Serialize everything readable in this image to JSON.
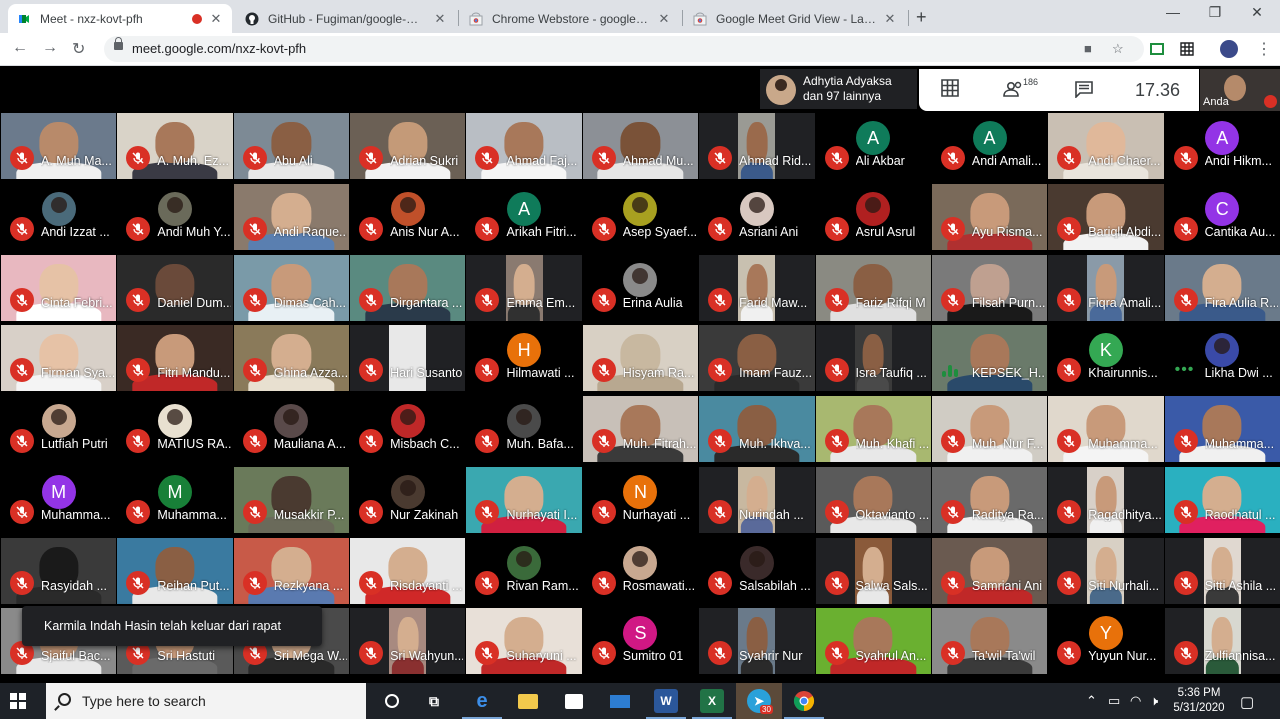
{
  "browser": {
    "tabs": [
      {
        "title": "Meet - nxz-kovt-pfh",
        "active": true,
        "recording": true,
        "icon": "meet-icon"
      },
      {
        "title": "GitHub - Fugiman/google-meet",
        "active": false,
        "icon": "github-icon"
      },
      {
        "title": "Chrome Webstore - google mee",
        "active": false,
        "icon": "chrome-webstore-icon"
      },
      {
        "title": "Google Meet Grid View - Lapork",
        "active": false,
        "icon": "chrome-webstore-icon"
      }
    ],
    "new_tab": "+",
    "url": "meet.google.com/nxz-kovt-pfh"
  },
  "meet": {
    "speaker_line1": "Adhytia Adyaksa",
    "speaker_line2": "dan 97 lainnya",
    "participant_count": "186",
    "clock": "17.36",
    "self_label": "Anda",
    "toast": "Karmila Indah Hasin telah keluar dari rapat",
    "participants": [
      {
        "name": "A. Muh Ma...",
        "kind": "video",
        "bg": "#6b7a8c",
        "skin": "#b88a6a",
        "shirt": "#f0f0f0"
      },
      {
        "name": "A. Muh. Ez...",
        "kind": "video",
        "bg": "#d9d3c8",
        "skin": "#a8785a",
        "shirt": "#3a3a44"
      },
      {
        "name": "Abu Ali",
        "kind": "video",
        "bg": "#7d8a95",
        "skin": "#8a5f44",
        "shirt": "#e8e8e8"
      },
      {
        "name": "Adrian Sukri",
        "kind": "video",
        "bg": "#6b6055",
        "skin": "#c49a78",
        "shirt": "#f2f2f2"
      },
      {
        "name": "Ahmad Faj...",
        "kind": "video",
        "bg": "#b9bec4",
        "skin": "#a8785a",
        "shirt": "#f5f5f5"
      },
      {
        "name": "Ahmad Mu...",
        "kind": "video",
        "bg": "#8c9096",
        "skin": "#7a5238",
        "shirt": "#e6e6e6"
      },
      {
        "name": "Ahmad Rid...",
        "kind": "narrow",
        "bg": "#9a9a94",
        "skin": "#9a6a4c",
        "shirt": "#3b5a8a"
      },
      {
        "name": "Ali Akbar",
        "kind": "avatar",
        "letter": "A",
        "color": "#0f7b5a"
      },
      {
        "name": "Andi Amali...",
        "kind": "avatar",
        "letter": "A",
        "color": "#0f7b5a"
      },
      {
        "name": "Andi Chaer...",
        "kind": "video",
        "bg": "#c9bfb3",
        "skin": "#e0b89a",
        "shirt": "#e9e4dc"
      },
      {
        "name": "Andi Hikm...",
        "kind": "avatar",
        "letter": "A",
        "color": "#9334e6"
      },
      {
        "name": "Andi Izzat ...",
        "kind": "photo",
        "color": "#4a6a7a"
      },
      {
        "name": "Andi Muh Y...",
        "kind": "photo",
        "color": "#6a6a5a"
      },
      {
        "name": "Andi Raque...",
        "kind": "video",
        "bg": "#8a7a6c",
        "skin": "#d4ae8f",
        "shirt": "#5a7fb0"
      },
      {
        "name": "Anis Nur A...",
        "kind": "photo",
        "color": "#c0502a"
      },
      {
        "name": "Arikah Fitri...",
        "kind": "avatar",
        "letter": "A",
        "color": "#0f7b5a"
      },
      {
        "name": "Asep Syaef...",
        "kind": "photo",
        "color": "#a8a020"
      },
      {
        "name": "Asriani Ani",
        "kind": "photo",
        "color": "#d8c8c0"
      },
      {
        "name": "Asrul Asrul",
        "kind": "photo",
        "color": "#b02020"
      },
      {
        "name": "Ayu Risma...",
        "kind": "video",
        "bg": "#7a6a5a",
        "skin": "#c89a7a",
        "shirt": "#b03030"
      },
      {
        "name": "Bariqli Abdi...",
        "kind": "video",
        "bg": "#4a3a30",
        "skin": "#c89a7a",
        "shirt": "#f2f2f2"
      },
      {
        "name": "Cantika Au...",
        "kind": "avatar",
        "letter": "C",
        "color": "#9334e6"
      },
      {
        "name": "Cinta Febri...",
        "kind": "video",
        "bg": "#e8b8c0",
        "skin": "#e6c2a6",
        "shirt": "#ffffff"
      },
      {
        "name": "Daniel Dum...",
        "kind": "video",
        "bg": "#2a2a2a",
        "skin": "#6a4a3a",
        "shirt": "#2a2a2a"
      },
      {
        "name": "Dimas Cah...",
        "kind": "video",
        "bg": "#7a9aa8",
        "skin": "#c89a7a",
        "shirt": "#e8f0f4"
      },
      {
        "name": "Dirgantara ...",
        "kind": "video",
        "bg": "#5a8a80",
        "skin": "#a8785a",
        "shirt": "#2a3a4a"
      },
      {
        "name": "Emma Em...",
        "kind": "narrow",
        "bg": "#8a7a70",
        "skin": "#d4ae8f",
        "shirt": "#303030"
      },
      {
        "name": "Erina Aulia",
        "kind": "photo",
        "color": "#8a8a8a"
      },
      {
        "name": "Farid Maw...",
        "kind": "narrow",
        "bg": "#c8c0b0",
        "skin": "#a8785a",
        "shirt": "#f0f0f0"
      },
      {
        "name": "Fariz Rifqi M",
        "kind": "video",
        "bg": "#8a8a82",
        "skin": "#8a5f44",
        "shirt": "#e0e0e0"
      },
      {
        "name": "Filsah Purn...",
        "kind": "video",
        "bg": "#7a7a7a",
        "skin": "#bfa090",
        "shirt": "#1a1a1a"
      },
      {
        "name": "Fiqra Amali...",
        "kind": "narrow",
        "bg": "#8a9aa8",
        "skin": "#c89a7a",
        "shirt": "#4a6a9a"
      },
      {
        "name": "Fira Aulia R...",
        "kind": "video",
        "bg": "#6a7a8a",
        "skin": "#d4ae8f",
        "shirt": "#3a5a8a"
      },
      {
        "name": "Firman Sya...",
        "kind": "video",
        "bg": "#d8d0c8",
        "skin": "#e6c2a6",
        "shirt": "#f4f4f4"
      },
      {
        "name": "Fitri Mandu...",
        "kind": "video",
        "bg": "#3a2a24",
        "skin": "#c89a7a",
        "shirt": "#c02828"
      },
      {
        "name": "Ghina Azza...",
        "kind": "video",
        "bg": "#8a7a5a",
        "skin": "#d4ae8f",
        "shirt": "#e8e0d0"
      },
      {
        "name": "Hari Susanto",
        "kind": "narrow",
        "bg": "#e8e8e8",
        "skin": "#e8e8e8",
        "shirt": "#e8e8e8"
      },
      {
        "name": "Hilmawati ...",
        "kind": "avatar",
        "letter": "H",
        "color": "#e8710a"
      },
      {
        "name": "Hisyam Ra...",
        "kind": "video",
        "bg": "#d8d0c4",
        "skin": "#c8b8a0",
        "shirt": "#b8a890"
      },
      {
        "name": "Imam Fauz...",
        "kind": "video",
        "bg": "#3a3a3a",
        "skin": "#8a5f44",
        "shirt": "#2a2a2a"
      },
      {
        "name": "Isra Taufiq ...",
        "kind": "narrow",
        "bg": "#3a3a3a",
        "skin": "#8a5f44",
        "shirt": "#4a4a4a"
      },
      {
        "name": "KEPSEK_H...",
        "kind": "speaking",
        "bg": "#6a7a6a",
        "skin": "#a8785a",
        "shirt": "#2a4a6a"
      },
      {
        "name": "Khairunnis...",
        "kind": "avatar",
        "letter": "K",
        "color": "#34a853"
      },
      {
        "name": "Likha Dwi ...",
        "kind": "photo-dots",
        "color": "#3a4aa8"
      },
      {
        "name": "Lutfiah Putri",
        "kind": "photo",
        "color": "#c8a890"
      },
      {
        "name": "MATIUS RA...",
        "kind": "photo",
        "color": "#e8e0d0"
      },
      {
        "name": "Mauliana A...",
        "kind": "photo",
        "color": "#5a4a4a"
      },
      {
        "name": "Misbach C...",
        "kind": "photo",
        "color": "#c02828"
      },
      {
        "name": "Muh. Bafa...",
        "kind": "photo",
        "color": "#4a4a4a"
      },
      {
        "name": "Muh. Fitrah...",
        "kind": "video",
        "bg": "#c8c0b8",
        "skin": "#a8785a",
        "shirt": "#3a3a3a"
      },
      {
        "name": "Muh. Ikhva...",
        "kind": "video",
        "bg": "#4a8aa0",
        "skin": "#8a5f44",
        "shirt": "#2a2a2a"
      },
      {
        "name": "Muh. Khafi ...",
        "kind": "video",
        "bg": "#a8b870",
        "skin": "#a8785a",
        "shirt": "#e8e8e8"
      },
      {
        "name": "Muh. Nur F...",
        "kind": "video",
        "bg": "#d0ccc4",
        "skin": "#c89a7a",
        "shirt": "#f0f0f0"
      },
      {
        "name": "Muhamma...",
        "kind": "video",
        "bg": "#e0d8cc",
        "skin": "#c89a7a",
        "shirt": "#f4f4f4"
      },
      {
        "name": "Muhamma...",
        "kind": "video",
        "bg": "#3a5aa8",
        "skin": "#a8785a",
        "shirt": "#f0f0f0"
      },
      {
        "name": "Muhamma...",
        "kind": "avatar",
        "letter": "M",
        "color": "#9334e6"
      },
      {
        "name": "Muhamma...",
        "kind": "avatar",
        "letter": "M",
        "color": "#188038"
      },
      {
        "name": "Musakkir P...",
        "kind": "video",
        "bg": "#6a7a5a",
        "skin": "#4a3a30",
        "shirt": "#6a6a5a"
      },
      {
        "name": "Nur Zakinah",
        "kind": "photo",
        "color": "#4a3a30"
      },
      {
        "name": "Nurhayati I...",
        "kind": "video",
        "bg": "#3aa8b0",
        "skin": "#d4ae8f",
        "shirt": "#d02040"
      },
      {
        "name": "Nurhayati ...",
        "kind": "avatar",
        "letter": "N",
        "color": "#e8710a"
      },
      {
        "name": "Nurindah ...",
        "kind": "narrow",
        "bg": "#c8b8a0",
        "skin": "#d4ae8f",
        "shirt": "#5a6a9a"
      },
      {
        "name": "Oktavianto ...",
        "kind": "video",
        "bg": "#5a5a5a",
        "skin": "#a8785a",
        "shirt": "#e8e8e8"
      },
      {
        "name": "Raditya Ra...",
        "kind": "video",
        "bg": "#6a6a6a",
        "skin": "#c89a7a",
        "shirt": "#f0f0f0"
      },
      {
        "name": "Ragadhitya...",
        "kind": "narrow",
        "bg": "#d8d0c8",
        "skin": "#c89a7a",
        "shirt": "#f0f0f0"
      },
      {
        "name": "Raodhatul ...",
        "kind": "video",
        "bg": "#2ab0c0",
        "skin": "#d4ae8f",
        "shirt": "#e02060"
      },
      {
        "name": "Rasyidah ...",
        "kind": "video",
        "bg": "#3a3a3a",
        "skin": "#1a1a1a",
        "shirt": "#2a2a2a"
      },
      {
        "name": "Reihan Put...",
        "kind": "video",
        "bg": "#3a7aa0",
        "skin": "#8a5f44",
        "shirt": "#e8e8e8"
      },
      {
        "name": "Rezkyana ...",
        "kind": "video",
        "bg": "#c85a48",
        "skin": "#d4ae8f",
        "shirt": "#5a7ab0"
      },
      {
        "name": "Risdayanti ...",
        "kind": "video",
        "bg": "#e8e8e8",
        "skin": "#d4ae8f",
        "shirt": "#d02828"
      },
      {
        "name": "Rivan Ram...",
        "kind": "photo",
        "color": "#3a6a3a"
      },
      {
        "name": "Rosmawati...",
        "kind": "photo",
        "color": "#c8a890"
      },
      {
        "name": "Salsabilah ...",
        "kind": "photo",
        "color": "#3a2a2a"
      },
      {
        "name": "Salwa Sals...",
        "kind": "narrow",
        "bg": "#8a5a3a",
        "skin": "#d4ae8f",
        "shirt": "#e8e8e8"
      },
      {
        "name": "Samriani Ani",
        "kind": "video",
        "bg": "#6a5a50",
        "skin": "#c89a7a",
        "shirt": "#c02828"
      },
      {
        "name": "Siti Nurhali...",
        "kind": "narrow",
        "bg": "#d8d0c4",
        "skin": "#d4ae8f",
        "shirt": "#4a6a8a"
      },
      {
        "name": "Sitti Ashila ...",
        "kind": "narrow",
        "bg": "#e0d8d0",
        "skin": "#d4ae8f",
        "shirt": "#3a3a3a"
      },
      {
        "name": "Sjaiful Bac...",
        "kind": "video",
        "bg": "#8a8a8a",
        "skin": "#c89a7a",
        "shirt": "#e8e8e8"
      },
      {
        "name": "Sri Hastuti",
        "kind": "video",
        "bg": "#5a5a5a",
        "skin": "#c89a7a",
        "shirt": "#6a6a6a"
      },
      {
        "name": "Sri Mega W...",
        "kind": "video",
        "bg": "#4a4a4a",
        "skin": "#d4ae8f",
        "shirt": "#2a2a2a"
      },
      {
        "name": "Sri Wahyun...",
        "kind": "narrow",
        "bg": "#a88a80",
        "skin": "#d4ae8f",
        "shirt": "#8a3030"
      },
      {
        "name": "Suharyuni ...",
        "kind": "video",
        "bg": "#e8e0d8",
        "skin": "#d4ae8f",
        "shirt": "#c02828"
      },
      {
        "name": "Sumitro 01",
        "kind": "avatar",
        "letter": "S",
        "color": "#d01884"
      },
      {
        "name": "Syahrir Nur",
        "kind": "narrow",
        "bg": "#6a7a8a",
        "skin": "#8a5f44",
        "shirt": "#2a2a2a"
      },
      {
        "name": "Syahrul An...",
        "kind": "video",
        "bg": "#6ab030",
        "skin": "#a8785a",
        "shirt": "#c02828"
      },
      {
        "name": "Ta'wil Ta'wil",
        "kind": "video",
        "bg": "#8a8a8a",
        "skin": "#a8785a",
        "shirt": "#3a3a3a"
      },
      {
        "name": "Yuyun Nur...",
        "kind": "avatar",
        "letter": "Y",
        "color": "#e8710a"
      },
      {
        "name": "Zulfiannisa...",
        "kind": "narrow",
        "bg": "#d8d8d0",
        "skin": "#d4ae8f",
        "shirt": "#2a5a3a"
      }
    ]
  },
  "taskbar": {
    "search_placeholder": "Type here to search",
    "time": "5:36 PM",
    "date": "5/31/2020",
    "telegram_badge": "30"
  }
}
